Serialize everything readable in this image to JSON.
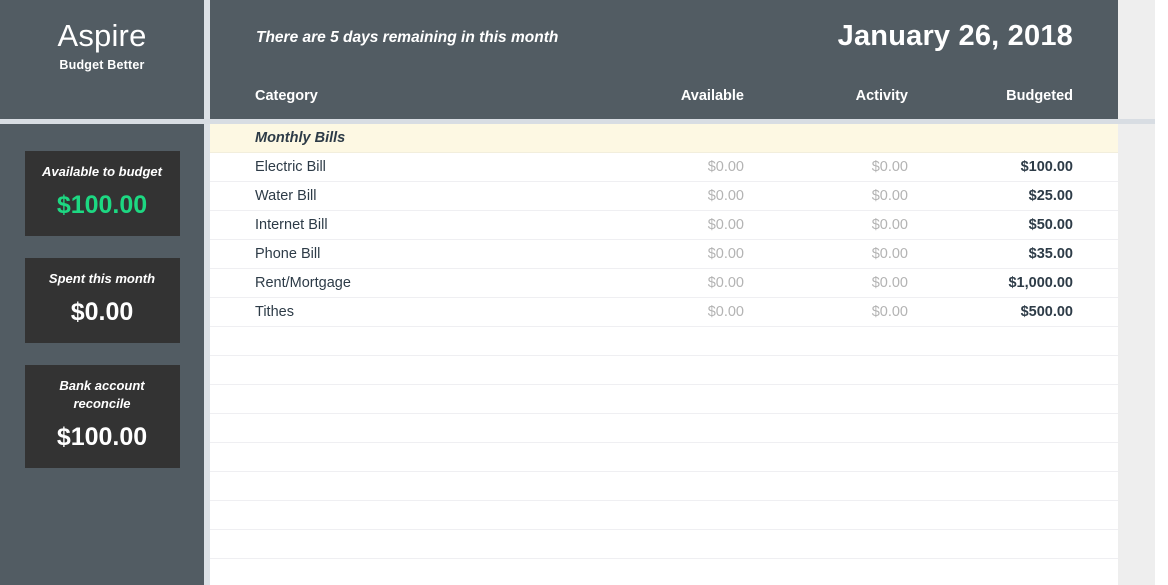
{
  "brand": {
    "title": "Aspire",
    "subtitle": "Budget Better"
  },
  "sidebar": {
    "cards": [
      {
        "label": "Available to budget",
        "value": "$100.00",
        "color": "#1DD882"
      },
      {
        "label": "Spent this month",
        "value": "$0.00",
        "color": "#FFFFFF"
      },
      {
        "label": "Bank account reconcile",
        "value": "$100.00",
        "color": "#FFFFFF"
      }
    ]
  },
  "header": {
    "note": "There are 5 days remaining in this month",
    "date": "January 26, 2018"
  },
  "table": {
    "columns": {
      "category": "Category",
      "available": "Available",
      "activity": "Activity",
      "budgeted": "Budgeted"
    },
    "groups": [
      {
        "name": "Monthly Bills",
        "rows": [
          {
            "category": "Electric Bill",
            "available": "$0.00",
            "activity": "$0.00",
            "budgeted": "$100.00"
          },
          {
            "category": "Water Bill",
            "available": "$0.00",
            "activity": "$0.00",
            "budgeted": "$25.00"
          },
          {
            "category": "Internet Bill",
            "available": "$0.00",
            "activity": "$0.00",
            "budgeted": "$50.00"
          },
          {
            "category": "Phone Bill",
            "available": "$0.00",
            "activity": "$0.00",
            "budgeted": "$35.00"
          },
          {
            "category": "Rent/Mortgage",
            "available": "$0.00",
            "activity": "$0.00",
            "budgeted": "$1,000.00"
          },
          {
            "category": "Tithes",
            "available": "$0.00",
            "activity": "$0.00",
            "budgeted": "$500.00"
          }
        ]
      }
    ],
    "empty_row_count": 9
  },
  "colors": {
    "sidebar_bg": "#525C63",
    "card_bg": "#333333",
    "accent_green": "#1DD882",
    "group_row_bg": "#FDF8E3",
    "text_dark": "#2D3B47",
    "text_muted": "#B3B3B3"
  }
}
